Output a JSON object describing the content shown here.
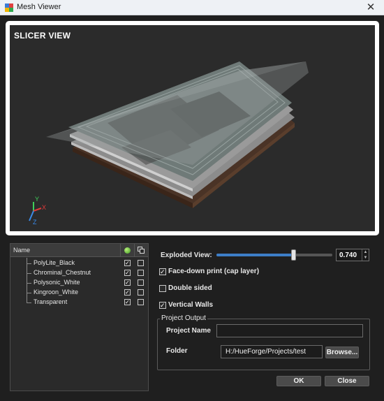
{
  "window": {
    "title": "Mesh Viewer",
    "close_glyph": "✕",
    "icon": "app-icon"
  },
  "viewport": {
    "label": "SLICER VIEW",
    "axes": {
      "x": "X",
      "y": "Y",
      "z": "Z"
    }
  },
  "layers": {
    "header": {
      "name": "Name",
      "visible_icon": "visibility-dot-icon",
      "copy_icon": "copy-icon"
    },
    "items": [
      {
        "label": "PolyLite_Black",
        "visible": true,
        "copy": false
      },
      {
        "label": "Chrominal_Chestnut",
        "visible": true,
        "copy": false
      },
      {
        "label": "Polysonic_White",
        "visible": true,
        "copy": false
      },
      {
        "label": "Kingroon_White",
        "visible": true,
        "copy": false
      },
      {
        "label": "Transparent",
        "visible": true,
        "copy": false
      }
    ]
  },
  "controls": {
    "exploded_view_label": "Exploded View:",
    "exploded_view_value": "0.740",
    "exploded_view_fraction": 0.74,
    "face_down_label": "Face-down print (cap layer)",
    "face_down_checked": true,
    "double_sided_label": "Double sided",
    "double_sided_checked": false,
    "vertical_walls_label": "Vertical Walls",
    "vertical_walls_checked": true
  },
  "project_output": {
    "group_label": "Project Output",
    "name_label": "Project Name",
    "name_value": "",
    "folder_label": "Folder",
    "folder_value": "H:/HueForge/Projects/test",
    "browse_label": "Browse..."
  },
  "footer": {
    "ok_label": "OK",
    "close_label": "Close"
  }
}
